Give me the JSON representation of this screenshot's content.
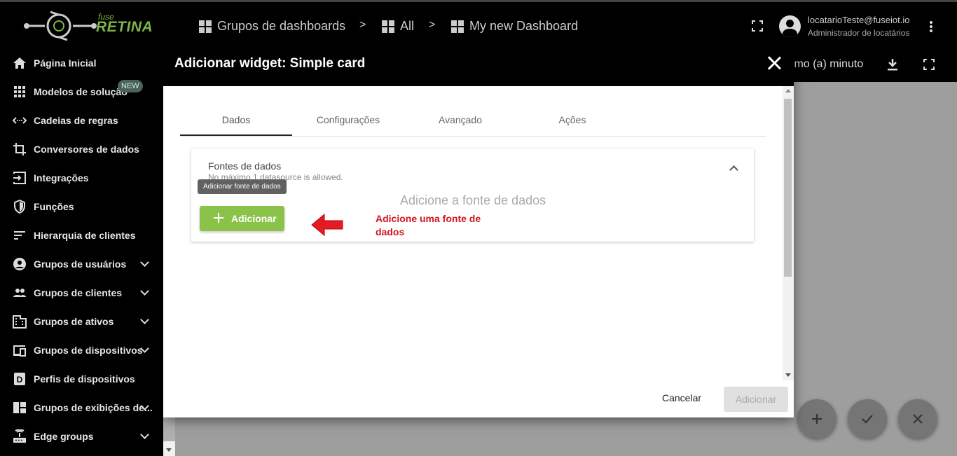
{
  "header": {
    "logo_small": "fuse",
    "logo_large": "RETINA",
    "breadcrumbs": [
      "Grupos de dashboards",
      "All",
      "My new Dashboard"
    ],
    "separator": ">",
    "user_email": "locatarioTeste@fuseiot.io",
    "user_role": "Administrador de locatários"
  },
  "sidebar": {
    "items": [
      {
        "label": "Página Inicial",
        "icon": "home-icon"
      },
      {
        "label": "Modelos de solução",
        "icon": "apps-icon",
        "badge": "NEW"
      },
      {
        "label": "Cadeias de regras",
        "icon": "code-arrows-icon"
      },
      {
        "label": "Conversores de dados",
        "icon": "crop-icon"
      },
      {
        "label": "Integrações",
        "icon": "input-icon"
      },
      {
        "label": "Funções",
        "icon": "shield-icon"
      },
      {
        "label": "Hierarquia de clientes",
        "icon": "sort-icon"
      },
      {
        "label": "Grupos de usuários",
        "icon": "account-circle-icon",
        "expandable": true
      },
      {
        "label": "Grupos de clientes",
        "icon": "people-icon",
        "expandable": true
      },
      {
        "label": "Grupos de ativos",
        "icon": "domain-icon",
        "expandable": true
      },
      {
        "label": "Grupos de dispositivos",
        "icon": "devices-icon",
        "expandable": true
      },
      {
        "label": "Perfis de dispositivos",
        "icon": "d-box-icon"
      },
      {
        "label": "Grupos de exibições de...",
        "icon": "dashboard-icon",
        "expandable": true
      },
      {
        "label": "Edge groups",
        "icon": "router-icon",
        "expandable": true
      }
    ]
  },
  "dashboard": {
    "toolbar_text": "imo (a) minuto"
  },
  "dialog": {
    "title": "Adicionar widget: Simple card",
    "tabs": [
      "Dados",
      "Configurações",
      "Avançado",
      "Ações"
    ],
    "active_tab": 0,
    "datasources": {
      "title": "Fontes de dados",
      "subtitle": "No máximo 1 datasource is allowed.",
      "empty_text": "Adicione a fonte de dados",
      "tooltip": "Adicionar fonte de dados",
      "add_label": "Adicionar"
    },
    "annotation": "Adicione uma fonte de dados",
    "cancel_label": "Cancelar",
    "submit_label": "Adicionar"
  },
  "colors": {
    "accent_green": "#8bc34a",
    "annotation_red": "#d0161c",
    "logo_green": "#7fb24a"
  }
}
